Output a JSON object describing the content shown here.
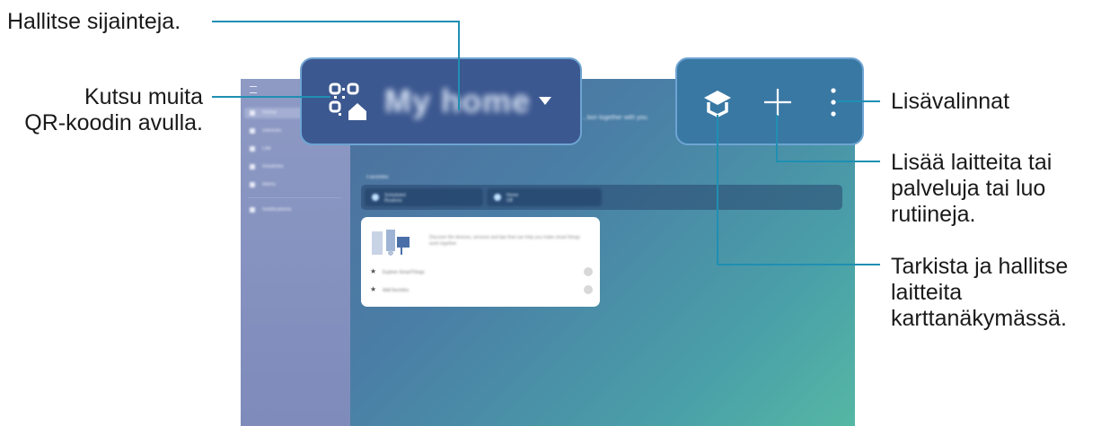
{
  "annotations": {
    "manage_locations": "Hallitse sijainteja.",
    "invite_line1": "Kutsu muita",
    "invite_line2": "QR-koodin avulla.",
    "more_options": "Lisävalinnat",
    "add_line1": "Lisää laitteita tai",
    "add_line2": "palveluja tai luo",
    "add_line3": "rutiineja.",
    "map_line1": "Tarkista ja hallitse",
    "map_line2": "laitteita",
    "map_line3": "karttanäkymässä."
  },
  "header": {
    "location_name": "My home",
    "tagline": "...tion together with you."
  },
  "sidebar": {
    "items": [
      {
        "label": "Home",
        "icon": "home-icon"
      },
      {
        "label": "Devices",
        "icon": "devices-icon"
      },
      {
        "label": "Life",
        "icon": "life-icon"
      },
      {
        "label": "Routines",
        "icon": "routines-icon"
      },
      {
        "label": "Menu",
        "icon": "menu-icon"
      }
    ],
    "notifications_label": "Notifications"
  },
  "favorites": {
    "label": "Favorites",
    "items": [
      {
        "line1": "Scheduled",
        "line2": "Routines"
      },
      {
        "line1": "Home",
        "line2": "Off"
      }
    ]
  },
  "card": {
    "description": "Discover the devices, services and tips that can help you make smart things work together.",
    "rows": [
      "Explore SmartThings",
      "Add favorites"
    ]
  },
  "icons": {
    "qr": "qr-home-icon",
    "map": "map-view-icon",
    "add": "add-icon",
    "more": "more-options-icon"
  },
  "colors": {
    "callout_line": "#1f8fb3",
    "panel_border": "#6ea4d2",
    "panel_left_bg": "#3c5890",
    "panel_right_bg": "#3a78a4"
  }
}
